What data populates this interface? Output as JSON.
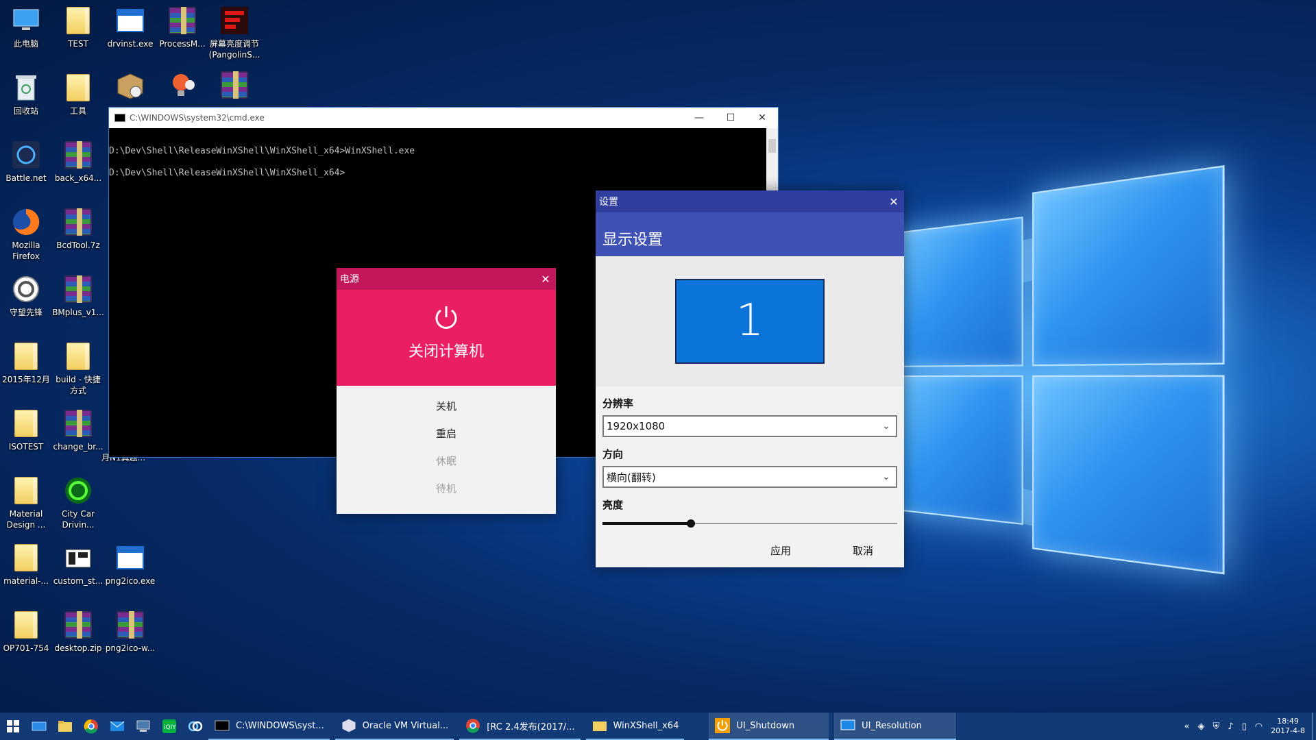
{
  "desktop": {
    "icons": [
      {
        "label": "此电脑",
        "icon": "this-pc-icon"
      },
      {
        "label": "TEST",
        "icon": "folder-icon"
      },
      {
        "label": "drvinst.exe",
        "icon": "exe-icon"
      },
      {
        "label": "ProcessM...",
        "icon": "rar-icon"
      },
      {
        "label": "屏幕亮度调节 (PangolinS...",
        "icon": "brightness-app-icon"
      },
      {
        "label": "回收站",
        "icon": "recycle-bin-icon"
      },
      {
        "label": "工具",
        "icon": "folder-icon"
      },
      {
        "label": "Battle.net",
        "icon": "battlenet-icon"
      },
      {
        "label": "back_x64...",
        "icon": "rar-icon"
      },
      {
        "label": "Mozilla Firefox",
        "icon": "firefox-icon"
      },
      {
        "label": "BcdTool.7z",
        "icon": "rar-icon"
      },
      {
        "label": "守望先锋",
        "icon": "overwatch-icon"
      },
      {
        "label": "BMplus_v1...",
        "icon": "rar-icon"
      },
      {
        "label": "2015年12月",
        "icon": "folder-icon"
      },
      {
        "label": "build - 快捷方式",
        "icon": "folder-shortcut-icon"
      },
      {
        "label": "ISOTEST",
        "icon": "folder-icon"
      },
      {
        "label": "change_br...",
        "icon": "rar-icon"
      },
      {
        "label": "月N1真题...",
        "icon": "file-icon"
      },
      {
        "label": "Material Design ...",
        "icon": "folder-icon"
      },
      {
        "label": "City Car Drivin...",
        "icon": "city-car-icon"
      },
      {
        "label": "material-...",
        "icon": "folder-icon"
      },
      {
        "label": "custom_st...",
        "icon": "custom-icon"
      },
      {
        "label": "png2ico.exe",
        "icon": "exe-icon"
      },
      {
        "label": "OP701-754",
        "icon": "folder-icon"
      },
      {
        "label": "desktop.zip",
        "icon": "rar-icon"
      },
      {
        "label": "png2ico-w...",
        "icon": "rar-icon"
      }
    ]
  },
  "cmd": {
    "title": "C:\\WINDOWS\\system32\\cmd.exe",
    "lines": [
      "D:\\Dev\\Shell\\ReleaseWinXShell\\WinXShell_x64>WinXShell.exe",
      "D:\\Dev\\Shell\\ReleaseWinXShell\\WinXShell_x64>"
    ],
    "min": "—",
    "max": "☐",
    "close": "✕"
  },
  "power": {
    "title": "电源",
    "close": "✕",
    "heading": "关闭计算机",
    "options": [
      {
        "label": "关机",
        "enabled": true
      },
      {
        "label": "重启",
        "enabled": true
      },
      {
        "label": "休眠",
        "enabled": false
      },
      {
        "label": "待机",
        "enabled": false
      }
    ],
    "accent": "#e91e63",
    "title_color": "#c2185b"
  },
  "settings": {
    "title": "设置",
    "close": "✕",
    "heading": "显示设置",
    "monitor_number": "1",
    "resolution_label": "分辨率",
    "resolution_value": "1920x1080",
    "orientation_label": "方向",
    "orientation_value": "横向(翻转)",
    "brightness_label": "亮度",
    "brightness_level": 0.3,
    "apply": "应用",
    "cancel": "取消",
    "accent": "#3f51b5",
    "title_color": "#303f9f"
  },
  "taskbar": {
    "apps": [
      {
        "label": "C:\\WINDOWS\\syst...",
        "icon": "cmd-icon"
      },
      {
        "label": "Oracle VM Virtual...",
        "icon": "virtualbox-icon"
      },
      {
        "label": "[RC 2.4发布(2017/...",
        "icon": "chrome-icon"
      },
      {
        "label": "WinXShell_x64",
        "icon": "folder-icon"
      },
      {
        "label": "UI_Shutdown",
        "icon": "power-icon"
      },
      {
        "label": "UI_Resolution",
        "icon": "display-icon"
      }
    ],
    "time": "18:49",
    "date": "2017-4-8"
  }
}
